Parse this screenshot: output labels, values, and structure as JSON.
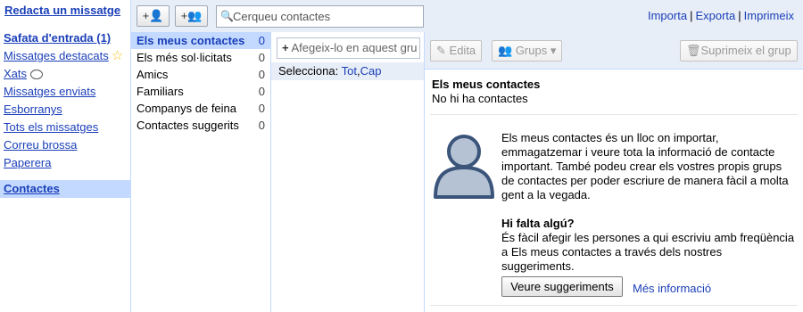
{
  "nav": {
    "compose": "Redacta un missatge",
    "items": [
      {
        "label": "Safata d'entrada (1)",
        "bold": true
      },
      {
        "label": "Missatges destacats",
        "icon": "star-icon"
      },
      {
        "label": "Xats",
        "icon": "chat-bubble-icon"
      },
      {
        "label": "Missatges enviats"
      },
      {
        "label": "Esborranys"
      },
      {
        "label": "Tots els missatges"
      },
      {
        "label": "Correu brossa"
      },
      {
        "label": "Paperera"
      }
    ],
    "contacts": "Contactes"
  },
  "topbar": {
    "add_contact_icon": "+👤",
    "add_group_icon": "+👥",
    "search_placeholder": "Cerqueu contactes",
    "links": [
      "Importa",
      "Exporta",
      "Imprimeix"
    ]
  },
  "groups": [
    {
      "name": "Els meus contactes",
      "count": "0",
      "selected": true
    },
    {
      "name": "Els més sol·licitats",
      "count": "0"
    },
    {
      "name": "Amics",
      "count": "0"
    },
    {
      "name": "Familiars",
      "count": "0"
    },
    {
      "name": "Companys de feina",
      "count": "0"
    },
    {
      "name": "Contactes suggerits",
      "count": "0"
    }
  ],
  "list": {
    "add_placeholder": "Afegeix-lo en aquest gru",
    "select_label": "Selecciona:",
    "select_all": "Tot",
    "select_none": "Cap"
  },
  "details": {
    "toolbar": {
      "edit": "Edita",
      "groups": "Grups",
      "delete_group": "Suprimeix el grup"
    },
    "title": "Els meus contactes",
    "subtitle": "No hi ha contactes",
    "para1": "Els meus contactes és un lloc on importar, emmagatzemar i veure tota la informació de contacte important. També podeu crear els vostres propis grups de contactes per poder escriure de manera fàcil a molta gent a la vegada.",
    "heading2": "Hi falta algú?",
    "para2": "És fàcil afegir les persones a qui escriviu amb freqüència a Els meus contactes a través dels nostres suggeriments.",
    "suggest_button": "Veure suggeriments",
    "more_info": "Més informació"
  }
}
